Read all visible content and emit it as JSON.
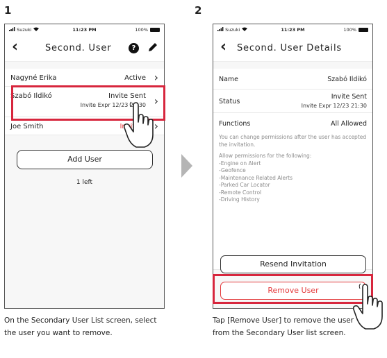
{
  "steps": {
    "one": "1",
    "two": "2"
  },
  "statusbar": {
    "carrier": "Suzuki",
    "time": "11:23 PM",
    "battery": "100%"
  },
  "screen1": {
    "title": "Second. User",
    "users": [
      {
        "name": "Nagyné Erika",
        "status": "Active"
      },
      {
        "name": "Szabó Ildikó",
        "status": "Invite Sent",
        "expiry": "Invite Expr 12/23 21:30"
      },
      {
        "name": "Joe Smith",
        "status": "Invite E"
      }
    ],
    "add_button": "Add User",
    "remaining": "1 left"
  },
  "screen2": {
    "title": "Second. User Details",
    "name_label": "Name",
    "name_value": "Szabó Ildikó",
    "status_label": "Status",
    "status_value": "Invite Sent",
    "status_expiry": "Invite Expr 12/23 21:30",
    "functions_label": "Functions",
    "functions_value": "All Allowed",
    "permissions_note": "You can change permissions after the user has accepted the invitation.",
    "allow_heading": "Allow permissions for the following:",
    "permissions": [
      "-Engine on Alert",
      "-Geofence",
      "-Maintenance Related Alerts",
      "-Parked Car Locator",
      "-Remote Control",
      "-Driving History"
    ],
    "resend_button": "Resend Invitation",
    "remove_button": "Remove User"
  },
  "captions": {
    "step1": "On the Secondary User List screen, select the user you want to remove.",
    "step2": "Tap [Remove User] to remove the user from the Secondary User list screen."
  },
  "colors": {
    "highlight": "#d7263d",
    "accent_red": "#e4383a"
  },
  "icons": [
    "signal-icon",
    "wifi-icon",
    "battery-icon",
    "back-icon",
    "help-icon",
    "edit-icon",
    "chevron-right-icon",
    "tap-hand-icon",
    "arrow-right-icon"
  ]
}
